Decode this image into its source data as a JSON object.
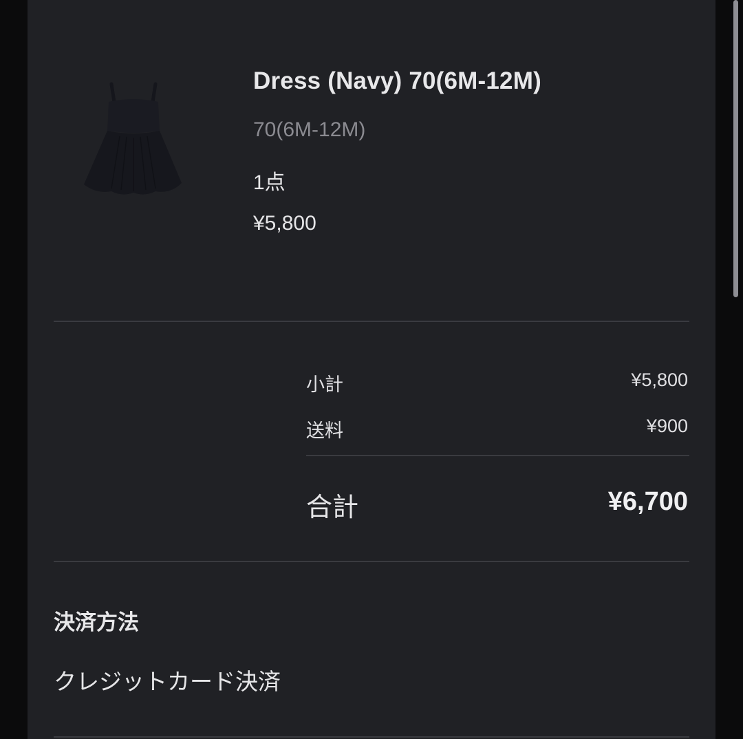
{
  "product": {
    "title": "Dress (Navy) 70(6M-12M)",
    "variant": "70(6M-12M)",
    "quantity": "1点",
    "price": "¥5,800",
    "image_icon": "navy-dress-image"
  },
  "summary": {
    "subtotal_label": "小計",
    "subtotal_value": "¥5,800",
    "shipping_label": "送料",
    "shipping_value": "¥900",
    "total_label": "合計",
    "total_value": "¥6,700"
  },
  "payment": {
    "heading": "決済方法",
    "method": "クレジットカード決済"
  },
  "colors": {
    "panel_background": "#202125",
    "page_background": "#0b0b0c",
    "muted_text": "#8b8b91",
    "divider": "#3a3b40"
  }
}
